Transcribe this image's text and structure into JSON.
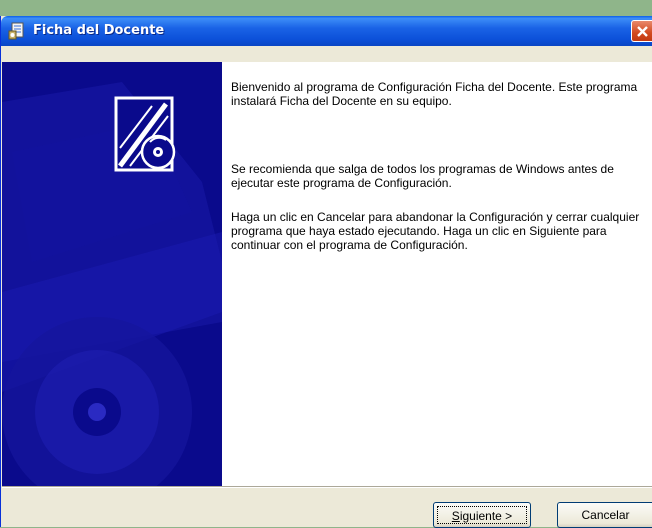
{
  "window": {
    "title": "Ficha del Docente",
    "icon": "setup-installer-icon",
    "close_icon": "close-icon"
  },
  "side_panel": {
    "logo": "install-cd-logo-icon",
    "background_art": "cd-disc-artwork"
  },
  "content": {
    "paragraphs": [
      "Bienvenido al programa de Configuración Ficha del Docente. Este programa instalará Ficha del Docente en su equipo.",
      "Se recomienda que salga de todos los programas de Windows antes de ejecutar este programa de Configuración.",
      "Haga un clic en Cancelar para abandonar la Configuración y cerrar cualquier programa que haya estado ejecutando. Haga un clic en Siguiente para continuar con el programa de Configuración."
    ]
  },
  "buttons": {
    "next_mnemonic": "S",
    "next_rest": "iguiente >",
    "cancel": "Cancelar"
  },
  "colors": {
    "titlebar": "#0b4fd8",
    "side_panel": "#0a0a8c",
    "close_button": "#d24a1f",
    "dialog_face": "#ece9d8"
  }
}
